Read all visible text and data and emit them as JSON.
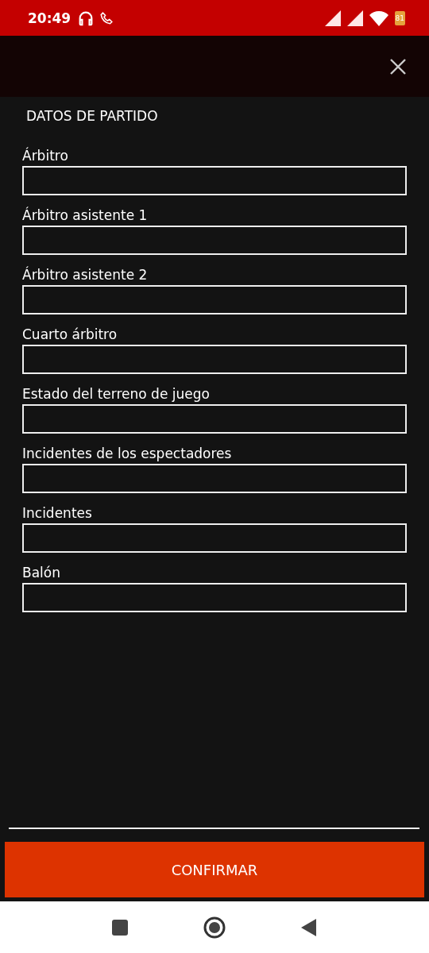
{
  "status_bar": {
    "time": "20:49",
    "battery": "81"
  },
  "dialog": {
    "title": "DATOS DE PARTIDO",
    "fields": [
      {
        "label": "Árbitro"
      },
      {
        "label": "Árbitro asistente 1"
      },
      {
        "label": "Árbitro asistente 2"
      },
      {
        "label": "Cuarto árbitro"
      },
      {
        "label": "Estado del terreno de juego"
      },
      {
        "label": "Incidentes de los espectadores"
      },
      {
        "label": "Incidentes"
      },
      {
        "label": "Balón"
      }
    ],
    "confirm_button": "CONFIRMAR"
  }
}
